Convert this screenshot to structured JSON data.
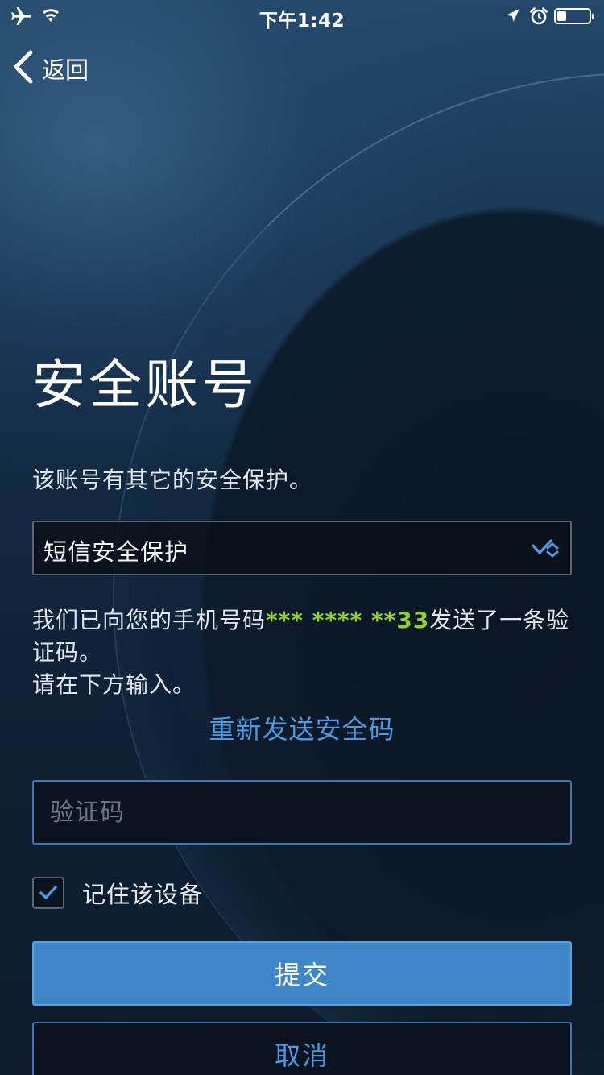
{
  "status_bar": {
    "time": "下午1:42",
    "icons": [
      "airplane-icon",
      "wifi-icon",
      "location-icon",
      "alarm-icon",
      "battery-icon"
    ],
    "battery_level": 0.3
  },
  "nav": {
    "back_label": "返回",
    "back_icon": "chevron-left-icon"
  },
  "title": "安全账号",
  "subtitle": "该账号有其它的安全保护。",
  "protection_select": {
    "selected": "短信安全保护",
    "icon": "select-caret-icon"
  },
  "info": {
    "prefix": "我们已向您的手机号码",
    "phone_masked": "*** **** **33",
    "suffix": "发送了一条验证码。",
    "line2": "请在下方输入。"
  },
  "resend_link": "重新发送安全码",
  "code_input": {
    "placeholder": "验证码",
    "value": ""
  },
  "remember_device": {
    "label": "记住该设备",
    "checked": true
  },
  "buttons": {
    "submit": "提交",
    "cancel": "取消"
  },
  "colors": {
    "accent": "#4d9ae0",
    "primary_button": "#3f86c9",
    "phone_highlight": "#8fd230"
  }
}
